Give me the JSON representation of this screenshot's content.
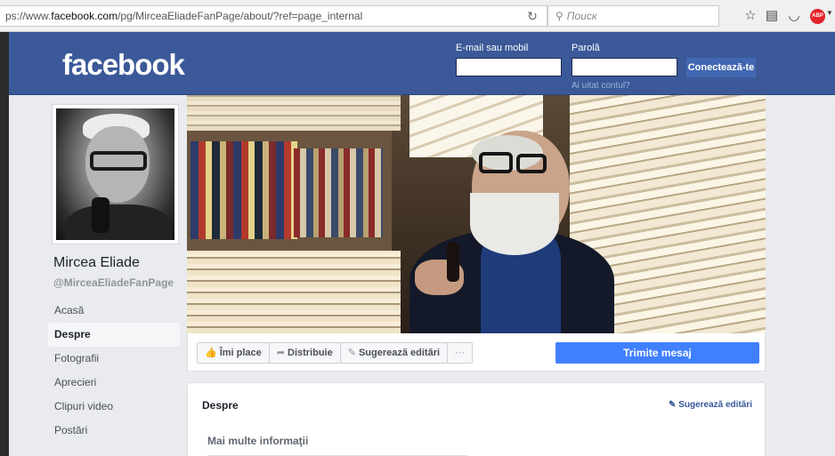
{
  "browser": {
    "url_prefix": "ps://www.",
    "url_host": "facebook.com",
    "url_path": "/pg/MirceaEliadeFanPage/about/?ref=page_internal",
    "search_placeholder": "Поиск",
    "abp_label": "ABP"
  },
  "header": {
    "logo": "facebook",
    "email_label": "E-mail sau mobil",
    "password_label": "Parolă",
    "login_button": "Conectează-te",
    "forgot_link": "Ai uitat contul?"
  },
  "profile": {
    "name": "Mircea Eliade",
    "handle": "@MirceaEliadeFanPage"
  },
  "nav": {
    "items": [
      "Acasă",
      "Despre",
      "Fotografii",
      "Aprecieri",
      "Clipuri video",
      "Postări"
    ],
    "active": "Despre"
  },
  "actions": {
    "like": "Îmi place",
    "share": "Distribuie",
    "suggest": "Sugerează editări",
    "more": "···",
    "send_message": "Trimite mesaj"
  },
  "about": {
    "title": "Despre",
    "suggest_edits": "Sugerează editări",
    "more_info": "Mai multe informaţii"
  },
  "colors": {
    "fb_blue": "#3b5998",
    "button_blue": "#4267b2",
    "message_blue": "#4080ff",
    "page_bg": "#e9ebee"
  }
}
